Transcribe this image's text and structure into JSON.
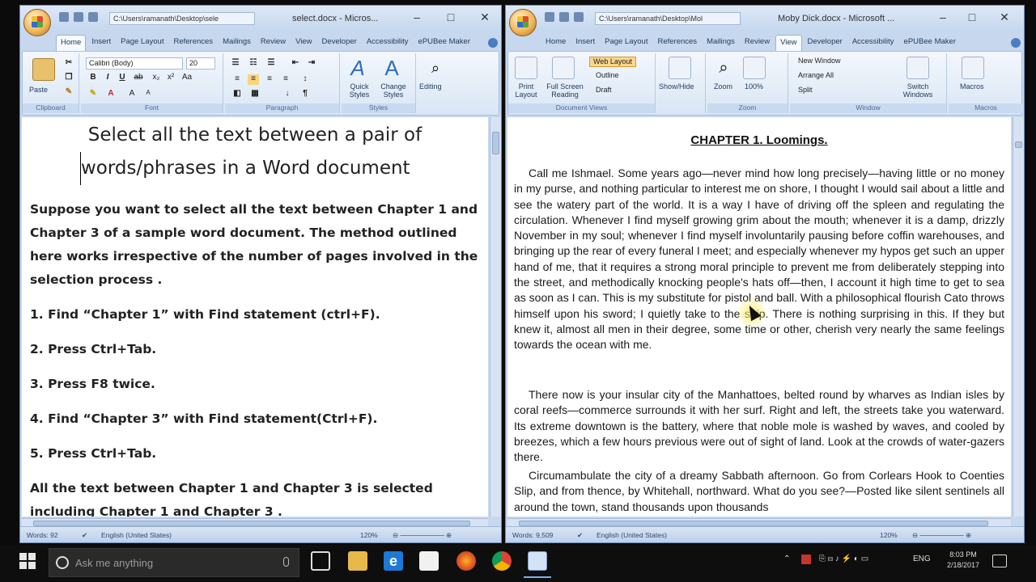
{
  "left_window": {
    "path": "C:\\Users\\ramanath\\Desktop\\sele",
    "title": "select.docx - Micros...",
    "tabs": [
      "Home",
      "Insert",
      "Page Layout",
      "References",
      "Mailings",
      "Review",
      "View",
      "Developer",
      "Accessibility",
      "ePUBee Maker"
    ],
    "active_tab": "Home",
    "ribbon": {
      "paste_label": "Paste",
      "font_name": "Calibri (Body)",
      "font_size": "20",
      "quick_styles_label": "Quick Styles",
      "change_styles_label": "Change Styles",
      "editing_label": "Editing",
      "groups": [
        "Clipboard",
        "Font",
        "Paragraph",
        "Styles"
      ]
    },
    "doc": {
      "title_line1": "Select all the text between a pair of",
      "title_line2": "words/phrases in a Word document",
      "intro": "Suppose you want to select all the text between Chapter 1 and Chapter 3 of a sample word document. The method outlined here works irrespective of the number of pages involved in the selection process .",
      "step1": "1. Find “Chapter 1” with Find statement (ctrl+F).",
      "step2": "2. Press Ctrl+Tab.",
      "step3": "3. Press F8 twice.",
      "step4": "4. Find “Chapter 3” with Find statement(Ctrl+F).",
      "step5": "5. Press Ctrl+Tab.",
      "conclusion": "All the text between Chapter 1 and Chapter 3 is selected including Chapter 1 and Chapter 3 ."
    },
    "status": {
      "words": "Words: 92",
      "language": "English (United States)",
      "zoom": "120%"
    }
  },
  "right_window": {
    "path": "C:\\Users\\ramanath\\Desktop\\Mol",
    "title": "Moby Dick.docx - Microsoft ...",
    "tabs": [
      "Home",
      "Insert",
      "Page Layout",
      "References",
      "Mailings",
      "Review",
      "View",
      "Developer",
      "Accessibility",
      "ePUBee Maker"
    ],
    "active_tab": "View",
    "ribbon": {
      "print_layout": "Print Layout",
      "full_screen_reading": "Full Screen Reading",
      "web_layout": "Web Layout",
      "outline": "Outline",
      "draft": "Draft",
      "show_hide": "Show/Hide",
      "zoom": "Zoom",
      "zoom_100": "100%",
      "new_window": "New Window",
      "arrange_all": "Arrange All",
      "split": "Split",
      "switch_windows": "Switch Windows",
      "macros": "Macros",
      "groups": [
        "Document Views",
        "Zoom",
        "Window",
        "Macros"
      ]
    },
    "doc": {
      "heading": "CHAPTER 1. Loomings.",
      "para1": "Call me Ishmael. Some years ago—never mind how long precisely—having little or no money in my purse, and nothing particular to interest me on shore, I thought I would sail about a little and see the watery part of the world. It is a way I have of driving off the spleen and regulating the circulation. Whenever I find myself growing grim about the mouth; whenever it is a damp, drizzly November in my soul; whenever I find myself involuntarily pausing before coffin warehouses, and bringing up the rear of every funeral I meet; and especially whenever my hypos get such an upper hand of me, that it requires a strong moral principle to prevent me from deliberately stepping into the street, and methodically knocking people's hats off—then, I account it high time to get to sea as soon as I can. This is my substitute for pistol and ball. With a philosophical flourish Cato throws himself upon his sword; I quietly take to the ship. There is nothing surprising in this. If they but knew it, almost all men in their degree, some time or other, cherish very nearly the same feelings towards the ocean with me.",
      "para2": "There now is your insular city of the Manhattoes, belted round by wharves as Indian isles by coral reefs—commerce surrounds it with her surf. Right and left, the streets take you waterward. Its extreme downtown is the battery, where that noble mole is washed by waves, and cooled by breezes, which a few hours previous were out of sight of land. Look at the crowds of water-gazers there.",
      "para3": "Circumambulate the city of a dreamy Sabbath afternoon. Go from Corlears Hook to Coenties Slip, and from thence, by Whitehall, northward. What do you see?—Posted like silent sentinels all around the town, stand thousands upon thousands"
    },
    "status": {
      "words": "Words: 9,509",
      "language": "English (United States)",
      "zoom": "120%"
    }
  },
  "taskbar": {
    "search_placeholder": "Ask me anything",
    "lang": "ENG",
    "time": "8:03 PM",
    "date": "2/18/2017"
  }
}
